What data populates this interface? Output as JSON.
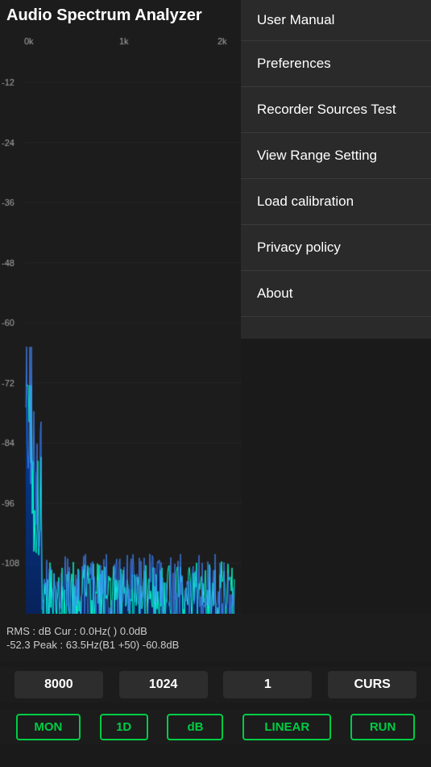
{
  "app": {
    "title": "Audio Spectrum Analyzer"
  },
  "menu": {
    "items": [
      {
        "id": "user-manual",
        "label": "User Manual"
      },
      {
        "id": "preferences",
        "label": "Preferences"
      },
      {
        "id": "recorder-sources-test",
        "label": "Recorder Sources Test"
      },
      {
        "id": "view-range-setting",
        "label": "View Range Setting"
      },
      {
        "id": "load-calibration",
        "label": "Load calibration"
      },
      {
        "id": "privacy-policy",
        "label": "Privacy policy"
      },
      {
        "id": "about",
        "label": "About"
      }
    ]
  },
  "chart": {
    "y_labels": [
      "0k",
      "1k",
      "2k"
    ],
    "x_labels": [
      "-12",
      "-24",
      "-36",
      "-48",
      "-60",
      "-72",
      "-84",
      "-96",
      "-108"
    ],
    "dB_label": "dB"
  },
  "status": {
    "line1": "RMS : dB    Cur :      0.0Hz(          )      0.0dB",
    "line2": "  -52.3    Peak :    63.5Hz(B1  +50)   -60.8dB"
  },
  "controls": {
    "btn1_label": "8000",
    "btn2_label": "1024",
    "btn3_label": "1",
    "btn4_label": "CURS",
    "btn_mon": "MON",
    "btn_1d": "1D",
    "btn_db": "dB",
    "btn_linear": "LINEAR",
    "btn_run": "RUN"
  },
  "colors": {
    "accent_green": "#00cc44",
    "bg_dark": "#1c1c1c",
    "bg_menu": "#2a2a2a",
    "text_white": "#ffffff",
    "text_gray": "#aaaaaa"
  }
}
